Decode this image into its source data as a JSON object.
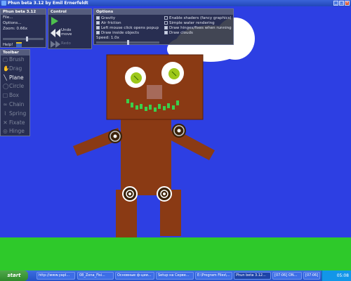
{
  "window": {
    "title": "Phun beta 3.12 by Emil Ernerfeldt"
  },
  "menu_panel": {
    "title": "Phun beta 3.12",
    "file": "File...",
    "options": "Options...",
    "zoom_label": "Zoom: 0.66x",
    "help": "Help!"
  },
  "control_panel": {
    "title": "Control",
    "undo_line1": "Undo",
    "undo_line2": "move",
    "redo": "Redo"
  },
  "options_panel": {
    "title": "Options",
    "left": [
      {
        "label": "Gravity",
        "checked": true
      },
      {
        "label": "Air friction",
        "checked": true
      },
      {
        "label": "Left mouse click opens popup",
        "checked": true
      },
      {
        "label": "Draw inside objects",
        "checked": true
      }
    ],
    "speed": "Speed: 1.0x",
    "right": [
      {
        "label": "Enable shaders (fancy graphics)",
        "checked": false
      },
      {
        "label": "Simple water rendering",
        "checked": false
      },
      {
        "label": "Draw hinges/fixes when running",
        "checked": true
      },
      {
        "label": "Draw clouds",
        "checked": true
      }
    ]
  },
  "toolbar": {
    "title": "Toolbar",
    "tools": [
      {
        "label": "Brush",
        "icon": "brush-icon",
        "glyph": "▢",
        "selected": false
      },
      {
        "label": "Drag",
        "icon": "hand-icon",
        "glyph": "✋",
        "selected": false
      },
      {
        "label": "Plane",
        "icon": "plane-icon",
        "glyph": "╲",
        "selected": true
      },
      {
        "label": "Circle",
        "icon": "circle-icon",
        "glyph": "◯",
        "selected": false
      },
      {
        "label": "Box",
        "icon": "box-icon",
        "glyph": "□",
        "selected": false
      },
      {
        "label": "Chain",
        "icon": "chain-icon",
        "glyph": "∞",
        "selected": false
      },
      {
        "label": "Spring",
        "icon": "spring-icon",
        "glyph": "⌇",
        "selected": false
      },
      {
        "label": "Fixate",
        "icon": "fixate-icon",
        "glyph": "✕",
        "selected": false
      },
      {
        "label": "Hinge",
        "icon": "hinge-icon",
        "glyph": "◎",
        "selected": false
      }
    ]
  },
  "taskbar": {
    "start": "start",
    "clock": "05:08",
    "items": [
      {
        "label": "http://www.yapl..."
      },
      {
        "label": "08_Zona_Fisi..."
      },
      {
        "label": "Основные ф-ции..."
      },
      {
        "label": "Setup на Серве..."
      },
      {
        "label": "E:\\Program Files\\..."
      },
      {
        "label": "Phun beta 3.12...",
        "active": true
      },
      {
        "label": "[07:06] ON..."
      },
      {
        "label": "[07:06] ON..."
      }
    ]
  },
  "colors": {
    "sky": "#2d3fe3",
    "grass": "#2ec92a",
    "robot": "#8a3a14",
    "eye": "#9dc81a",
    "mouth": "#3ad04b",
    "cloud": "#ffffff"
  }
}
